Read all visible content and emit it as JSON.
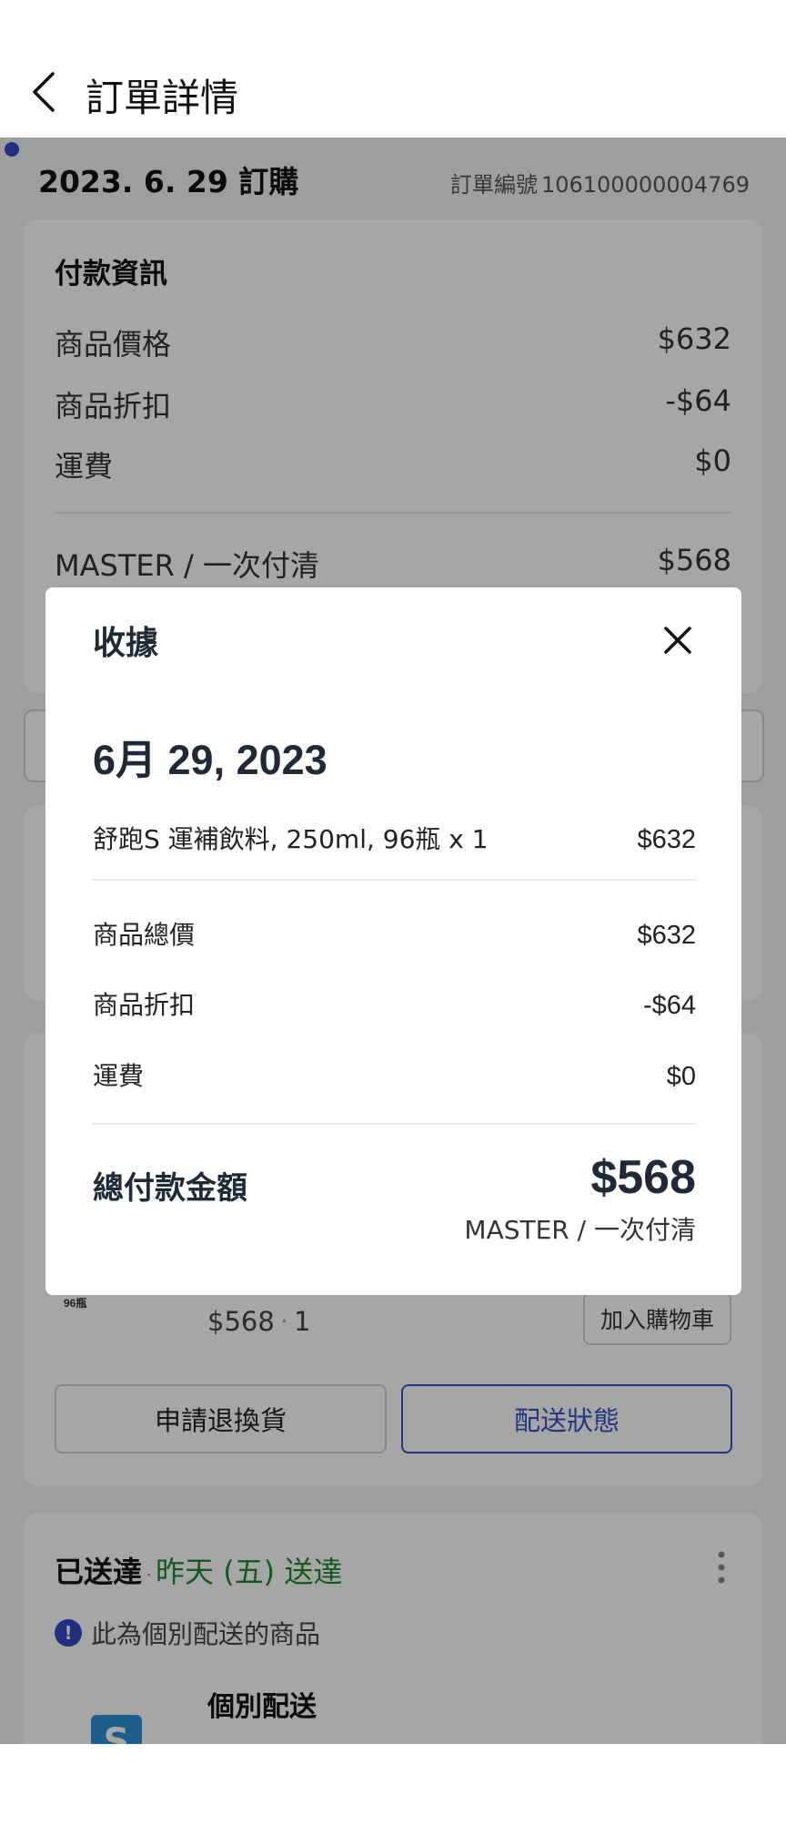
{
  "header": {
    "title": "訂單詳情"
  },
  "order": {
    "date": "2023. 6. 29 訂購",
    "number_label": "訂單編號",
    "number": "106100000004769"
  },
  "payment": {
    "title": "付款資訊",
    "rows": [
      {
        "label": "商品價格",
        "value": "$632"
      },
      {
        "label": "商品折扣",
        "value": "-$64"
      },
      {
        "label": "運費",
        "value": "$0"
      }
    ],
    "method": "MASTER / 一次付清",
    "total": "$568"
  },
  "product": {
    "thumb_label": "96瓶",
    "price": "$568",
    "qty": "1",
    "add_to_cart": "加入購物車",
    "return_button": "申請退換貨",
    "status_button": "配送狀態"
  },
  "delivery": {
    "status": "已送達",
    "eta": "昨天 (五) 送達",
    "notice": "此為個別配送的商品",
    "shipping_type": "個別配送",
    "thumb_letter": "S"
  },
  "receipt": {
    "title": "收據",
    "date": "6月 29, 2023",
    "item": {
      "name": "舒跑S 運補飲料, 250ml, 96瓶 x 1",
      "price": "$632"
    },
    "subtotal": {
      "label": "商品總價",
      "value": "$632"
    },
    "discount": {
      "label": "商品折扣",
      "value": "-$64"
    },
    "shipping": {
      "label": "運費",
      "value": "$0"
    },
    "total": {
      "label": "總付款金額",
      "value": "$568",
      "method": "MASTER / 一次付清"
    }
  },
  "colors": {
    "accent": "#3b52c4",
    "success": "#1f8a2e",
    "overlay": "rgba(0,0,0,0.35)"
  },
  "icons": {
    "back": "chevron-left-icon",
    "close": "close-icon",
    "more": "more-vertical-icon",
    "info": "info-icon"
  }
}
